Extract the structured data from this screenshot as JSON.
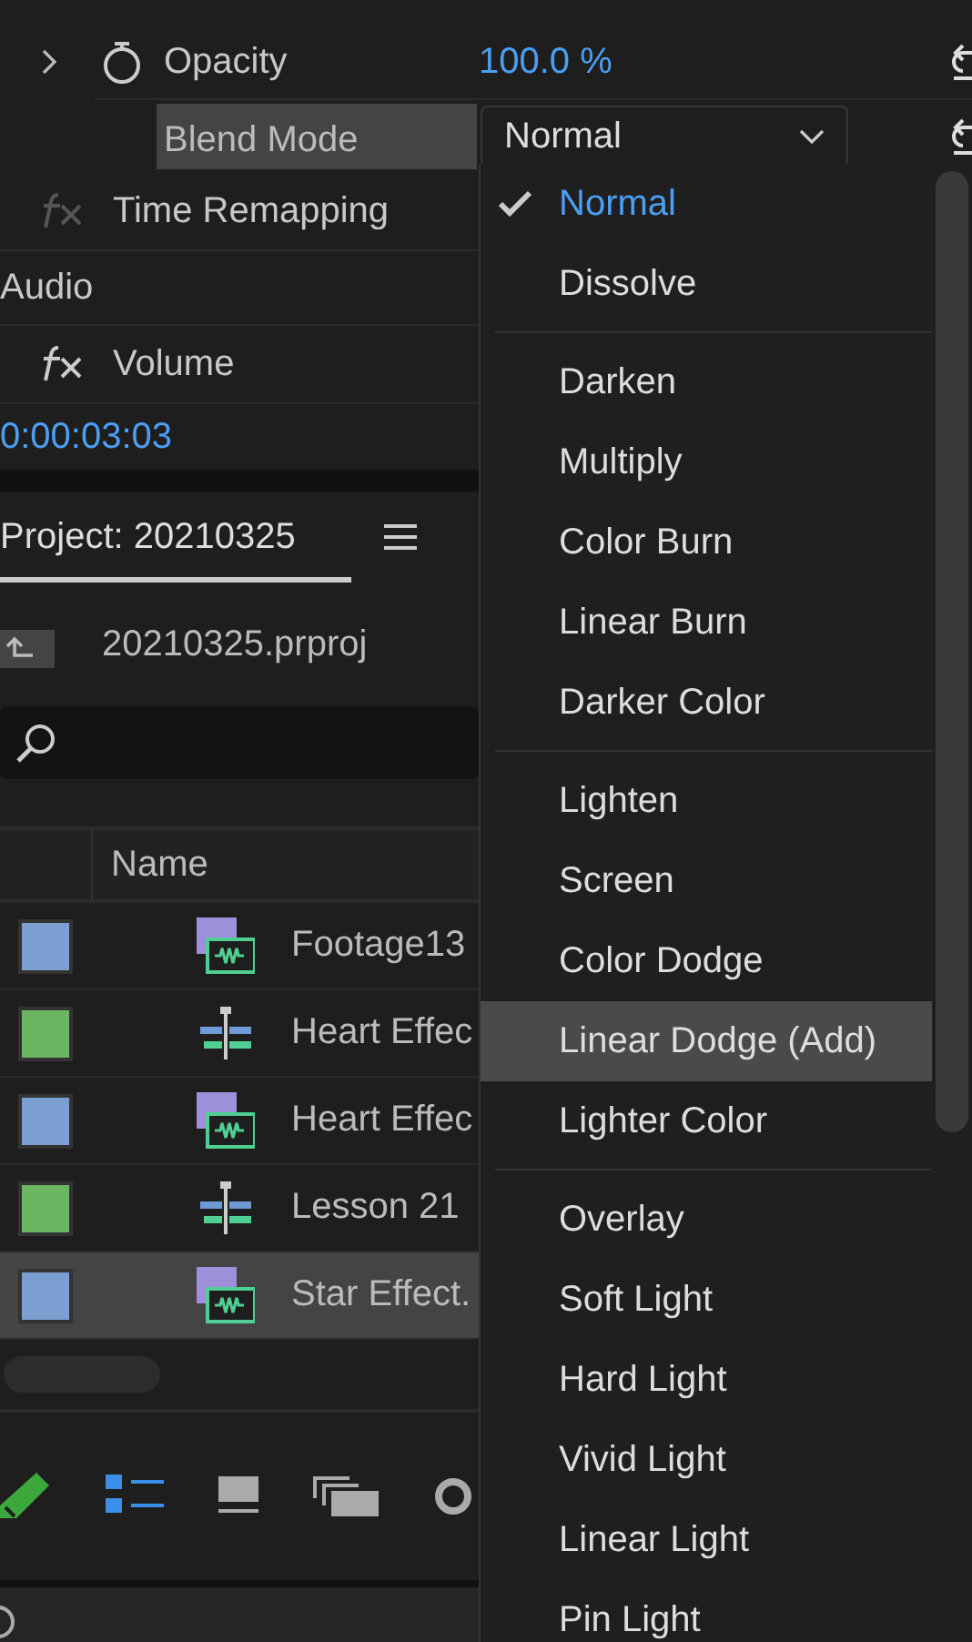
{
  "effect_controls": {
    "opacity": {
      "label": "Opacity",
      "value": "100.0 %"
    },
    "blend_mode": {
      "label": "Blend Mode",
      "value": "Normal"
    },
    "rows": [
      {
        "kind": "fx",
        "label": "Time Remapping",
        "enabled": false
      },
      {
        "kind": "heading",
        "label": "Audio"
      },
      {
        "kind": "fx",
        "label": "Volume",
        "enabled": true
      }
    ],
    "timecode": "0:00:03:03"
  },
  "project": {
    "tab": {
      "label": "Project: 20210325",
      "selected": true
    },
    "file": "20210325.prproj",
    "column": "Name",
    "items": [
      {
        "kind": "clip",
        "name": "Footage13",
        "color": "#7b9fd0",
        "selected": false
      },
      {
        "kind": "sequence",
        "name": "Heart Effec",
        "color": "#6ab663",
        "selected": false
      },
      {
        "kind": "clip",
        "name": "Heart Effec",
        "color": "#7b9fd0",
        "selected": false
      },
      {
        "kind": "sequence",
        "name": "Lesson 21",
        "color": "#6ab663",
        "selected": false
      },
      {
        "kind": "clip",
        "name": "Star Effect.",
        "color": "#7b9fd0",
        "selected": true
      }
    ],
    "toolbar": [
      {
        "kind": "pencil",
        "selected": false
      },
      {
        "kind": "list",
        "selected": true
      },
      {
        "kind": "icon",
        "selected": false
      },
      {
        "kind": "freeform",
        "selected": false
      },
      {
        "kind": "circle",
        "selected": false
      }
    ]
  },
  "blend_menu": {
    "groups": [
      {
        "items": [
          {
            "label": "Normal",
            "selected": true,
            "hovered": false
          },
          {
            "label": "Dissolve",
            "selected": false,
            "hovered": false
          }
        ]
      },
      {
        "items": [
          {
            "label": "Darken",
            "selected": false,
            "hovered": false
          },
          {
            "label": "Multiply",
            "selected": false,
            "hovered": false
          },
          {
            "label": "Color Burn",
            "selected": false,
            "hovered": false
          },
          {
            "label": "Linear Burn",
            "selected": false,
            "hovered": false
          },
          {
            "label": "Darker Color",
            "selected": false,
            "hovered": false
          }
        ]
      },
      {
        "items": [
          {
            "label": "Lighten",
            "selected": false,
            "hovered": false
          },
          {
            "label": "Screen",
            "selected": false,
            "hovered": false
          },
          {
            "label": "Color Dodge",
            "selected": false,
            "hovered": false
          },
          {
            "label": "Linear Dodge (Add)",
            "selected": false,
            "hovered": true
          },
          {
            "label": "Lighter Color",
            "selected": false,
            "hovered": false
          }
        ]
      },
      {
        "items": [
          {
            "label": "Overlay",
            "selected": false,
            "hovered": false
          },
          {
            "label": "Soft Light",
            "selected": false,
            "hovered": false
          },
          {
            "label": "Hard Light",
            "selected": false,
            "hovered": false
          },
          {
            "label": "Vivid Light",
            "selected": false,
            "hovered": false
          },
          {
            "label": "Linear Light",
            "selected": false,
            "hovered": false
          },
          {
            "label": "Pin Light",
            "selected": false,
            "hovered": false
          }
        ]
      }
    ]
  }
}
